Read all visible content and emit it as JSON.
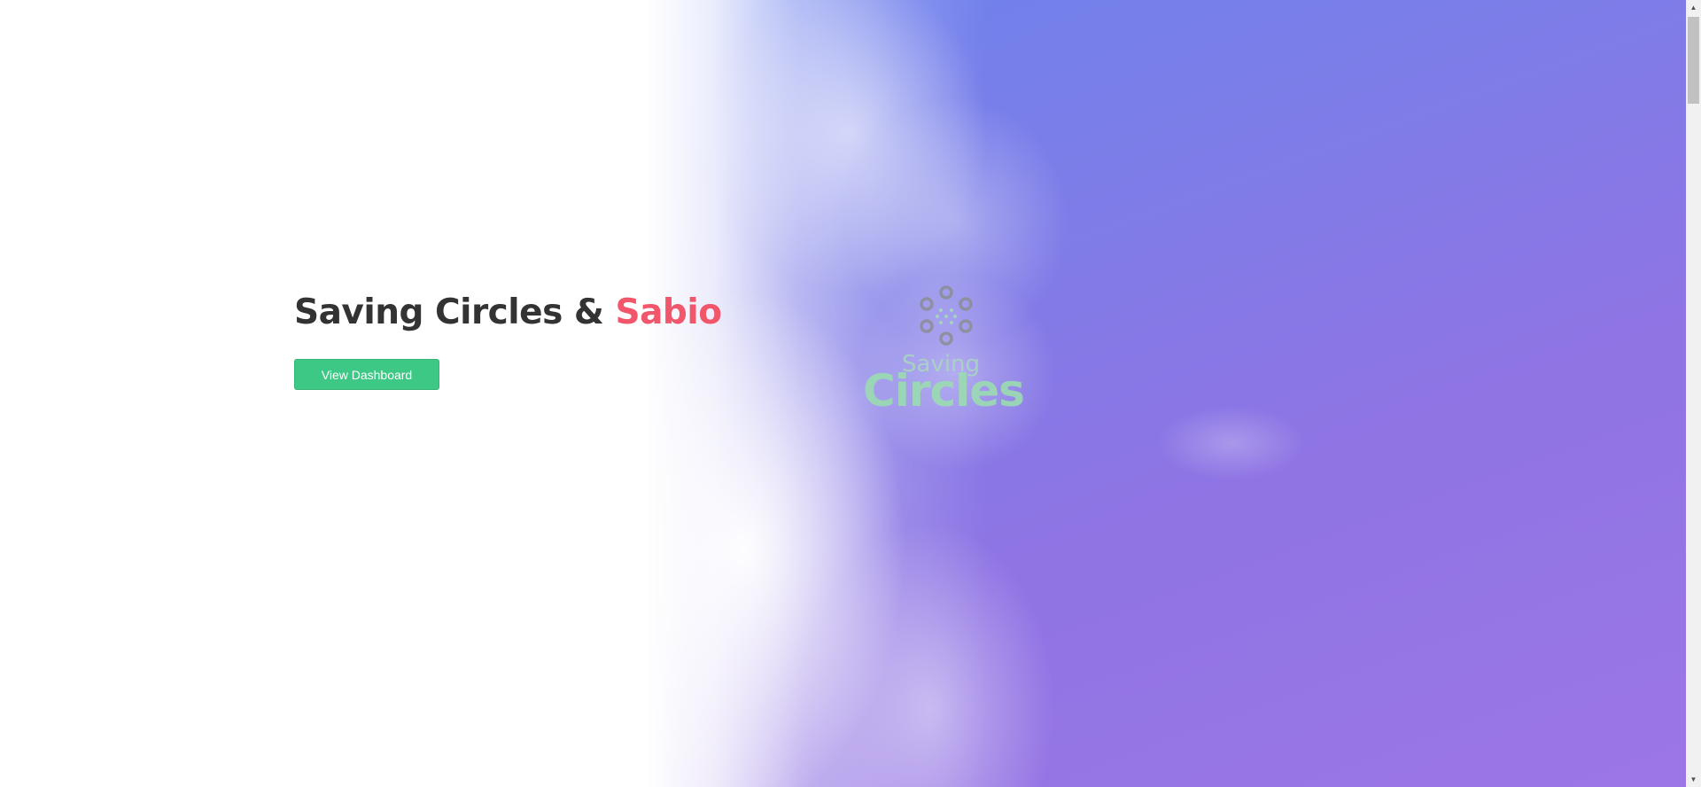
{
  "hero": {
    "title_main": "Saving Circles & ",
    "title_accent": "Sabio",
    "button_label": "View Dashboard"
  },
  "logo": {
    "top_text": "Saving",
    "bottom_text": "Circles",
    "icon": "saving-circles-logo-icon"
  },
  "colors": {
    "accent": "#f1566b",
    "button": "#3ec885",
    "title": "#333333",
    "gradient_start": "#6c83ee",
    "gradient_end": "#9c76e4"
  }
}
